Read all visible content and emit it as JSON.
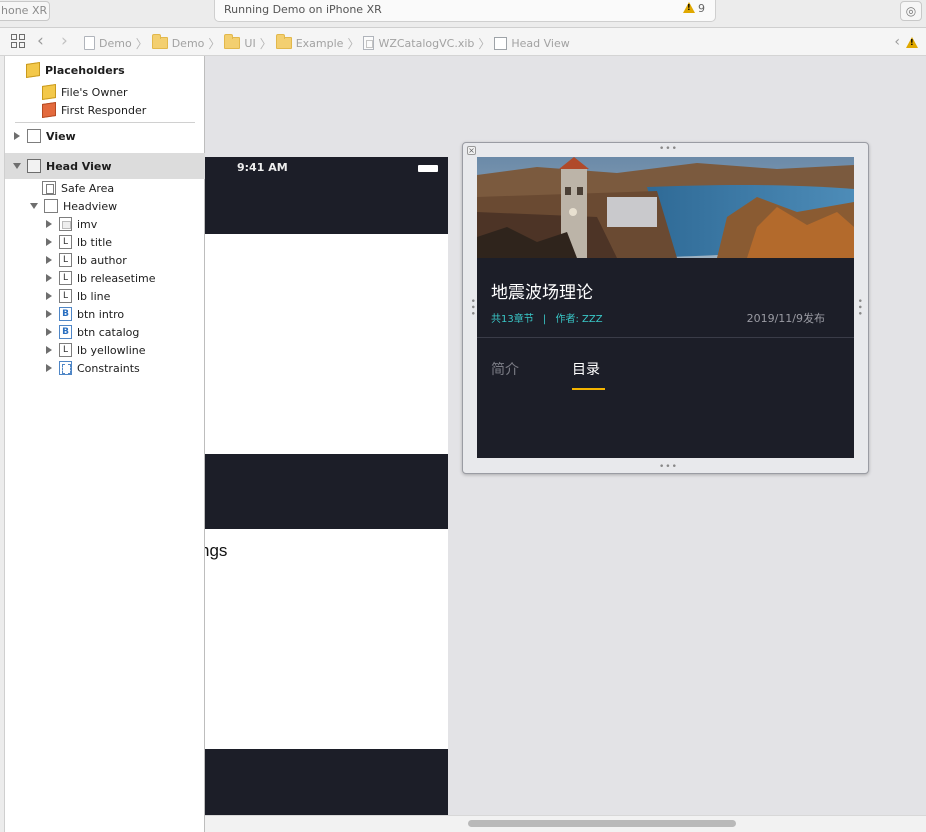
{
  "toolbar": {
    "scheme_label": "hone XR",
    "activity_status": "Running Demo on iPhone XR",
    "warning_count": "9"
  },
  "jumpbar": {
    "crumbs": [
      "Demo",
      "Demo",
      "UI",
      "Example",
      "WZCatalogVC.xib",
      "Head View"
    ]
  },
  "outline": {
    "placeholders_title": "Placeholders",
    "files_owner": "File's Owner",
    "first_responder": "First Responder",
    "view": "View",
    "head_view": "Head View",
    "safe_area": "Safe Area",
    "headview": "Headview",
    "children": [
      "imv",
      "lb title",
      "lb author",
      "lb releasetime",
      "lb line",
      "btn intro",
      "btn catalog",
      "lb yellowline",
      "Constraints"
    ]
  },
  "phone": {
    "time": "9:41 AM",
    "partial_text": "ngs"
  },
  "head_view": {
    "title": "地震波场理论",
    "chapters": "共13章节",
    "divider": "|",
    "author": "作者: ZZZ",
    "release_time": "2019/11/9发布",
    "tab_intro": "简介",
    "tab_catalog": "目录",
    "colors": {
      "background": "#1c1e28",
      "accent_cyan": "#39c7c7",
      "underline_yellow": "#f4b400"
    }
  }
}
